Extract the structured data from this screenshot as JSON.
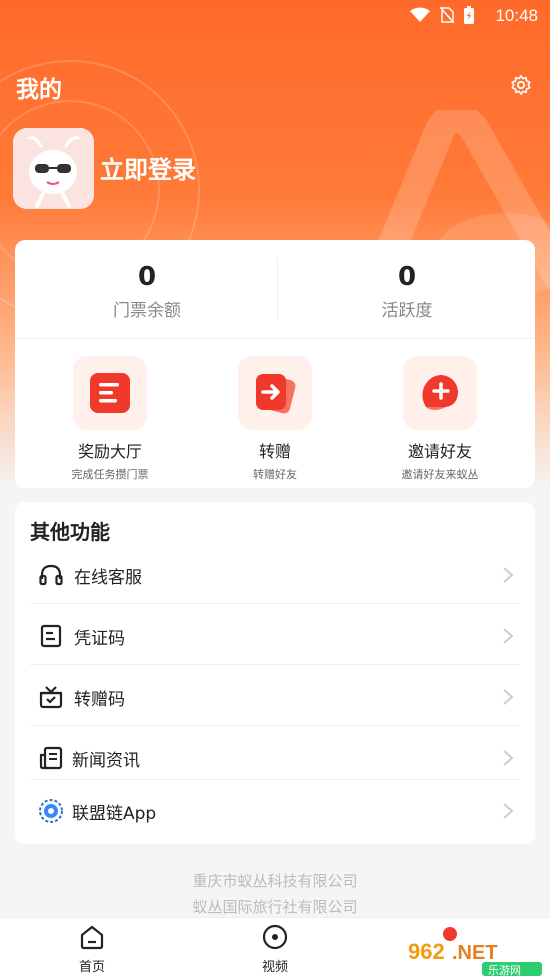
{
  "status_bar": {
    "time": "10:48"
  },
  "header": {
    "title": "我的",
    "login_label": "立即登录"
  },
  "stats": [
    {
      "value": "0",
      "label": "门票余额"
    },
    {
      "value": "0",
      "label": "活跃度"
    }
  ],
  "features": [
    {
      "title": "奖励大厅",
      "subtitle": "完成任务攒门票",
      "icon": "reward-hall-icon"
    },
    {
      "title": "转赠",
      "subtitle": "转赠好友",
      "icon": "transfer-icon"
    },
    {
      "title": "邀请好友",
      "subtitle": "邀请好友来蚁丛",
      "icon": "invite-icon"
    }
  ],
  "other": {
    "title": "其他功能",
    "items": [
      {
        "label": "在线客服",
        "icon": "headset-icon"
      },
      {
        "label": "凭证码",
        "icon": "voucher-icon"
      },
      {
        "label": "转赠码",
        "icon": "gift-icon"
      },
      {
        "label": "新闻资讯",
        "icon": "news-icon"
      },
      {
        "label": "联盟链App",
        "icon": "chain-app-icon"
      }
    ]
  },
  "footer": {
    "line1": "重庆市蚁丛科技有限公司",
    "line2": "蚁丛国际旅行社有限公司"
  },
  "tabbar": [
    {
      "label": "首页",
      "icon": "home-icon"
    },
    {
      "label": "视频",
      "icon": "video-icon"
    }
  ],
  "watermark": {
    "line1": "962.NET",
    "line2": "乐游网"
  },
  "colors": {
    "accent": "#ff6a2a",
    "icon_red": "#f0392b"
  }
}
